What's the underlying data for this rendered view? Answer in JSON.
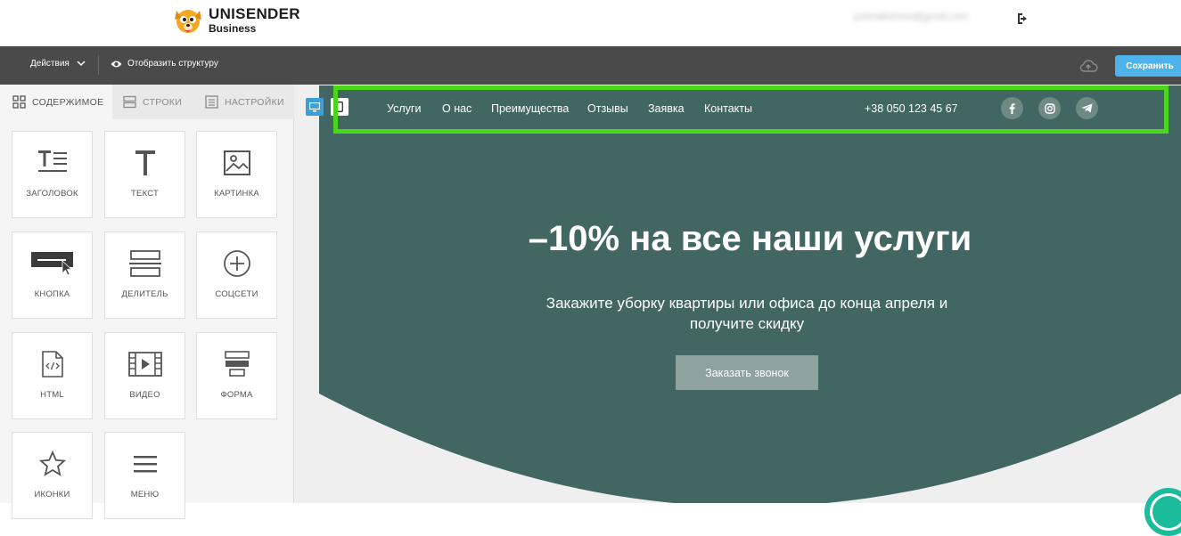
{
  "header": {
    "logo_main": "UNISENDER",
    "logo_sub": "Business",
    "user_email": "justmaksimov@gmail.com",
    "logout_icon": "logout-icon"
  },
  "toolbar": {
    "actions_label": "Действия",
    "structure_label": "Отобразить структуру",
    "save_label": "Сохранить",
    "save_color": "#4db3ea",
    "cloud_icon": "cloud-upload-icon"
  },
  "left_panel": {
    "tabs": [
      {
        "label": "СОДЕРЖИМОЕ",
        "icon": "grid-icon",
        "active": true
      },
      {
        "label": "СТРОКИ",
        "icon": "rows-icon",
        "active": false
      },
      {
        "label": "НАСТРОЙКИ",
        "icon": "settings-panel-icon",
        "active": false
      }
    ],
    "blocks": [
      {
        "label": "ЗАГОЛОВОК",
        "icon": "heading-icon"
      },
      {
        "label": "ТЕКСТ",
        "icon": "text-icon"
      },
      {
        "label": "КАРТИНКА",
        "icon": "image-icon"
      },
      {
        "label": "КНОПКА",
        "icon": "button-icon"
      },
      {
        "label": "ДЕЛИТЕЛЬ",
        "icon": "divider-icon"
      },
      {
        "label": "СОЦСЕТИ",
        "icon": "plus-circle-icon"
      },
      {
        "label": "HTML",
        "icon": "html-file-icon"
      },
      {
        "label": "ВИДЕО",
        "icon": "video-icon"
      },
      {
        "label": "ФОРМА",
        "icon": "form-icon"
      },
      {
        "label": "ИКОНКИ",
        "icon": "star-icon"
      },
      {
        "label": "МЕНЮ",
        "icon": "menu-icon"
      }
    ]
  },
  "canvas": {
    "nav_items": [
      "Услуги",
      "О нас",
      "Преимущества",
      "Отзывы",
      "Заявка",
      "Контакты"
    ],
    "phone": "+38 050 123 45 67",
    "socials": [
      "facebook-icon",
      "instagram-icon",
      "telegram-icon"
    ],
    "hero_title": "–10% на все наши услуги",
    "hero_subtitle": "Закажите уборку квартиры или офиса до конца апреля и получите скидку",
    "cta_label": "Заказать звонок",
    "hero_color": "#426661",
    "highlight_color": "#4cd61a"
  }
}
